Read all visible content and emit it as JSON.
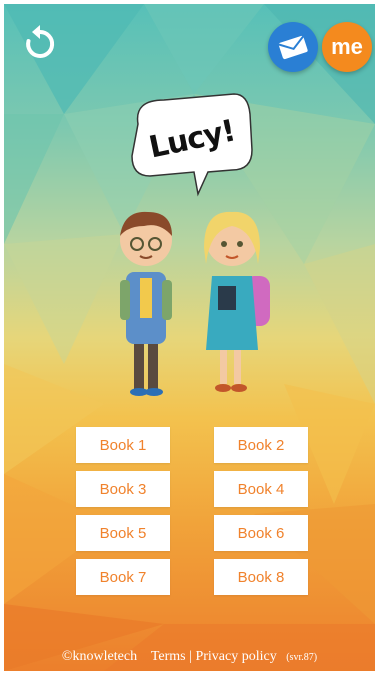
{
  "character": {
    "name": "Lucy!"
  },
  "header": {
    "refresh_icon": "refresh-icon",
    "mail_icon": "envelope-icon",
    "me_label": "me"
  },
  "books": [
    {
      "label": "Book 1"
    },
    {
      "label": "Book 2"
    },
    {
      "label": "Book 3"
    },
    {
      "label": "Book 4"
    },
    {
      "label": "Book 5"
    },
    {
      "label": "Book 6"
    },
    {
      "label": "Book 7"
    },
    {
      "label": "Book 8"
    }
  ],
  "footer": {
    "copyright": "©knowletech",
    "terms": "Terms",
    "separator": "|",
    "privacy": "Privacy policy",
    "version": "(svr.87)"
  },
  "colors": {
    "accent_orange": "#f48a1e",
    "mail_blue": "#2a7fd4",
    "book_text": "#f0822c"
  }
}
